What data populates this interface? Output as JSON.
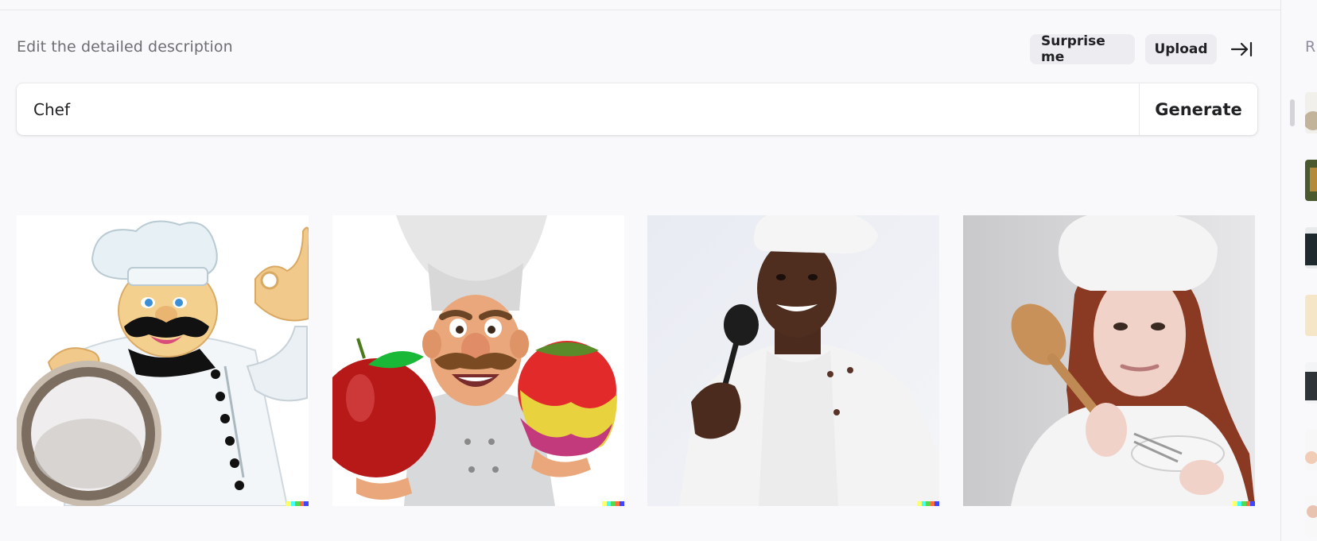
{
  "editor": {
    "label": "Edit the detailed description",
    "surprise_label": "Surprise me",
    "upload_label": "Upload",
    "prompt_value": "Chef",
    "generate_label": "Generate"
  },
  "results": {
    "images": [
      {
        "alt": "cartoon chef with mustache holding a tray and making an OK sign"
      },
      {
        "alt": "3D cartoon chef holding an apple and a dripping strawberry"
      },
      {
        "alt": "photo of a smiling chef holding a black ladle"
      },
      {
        "alt": "photo of a young woman chef holding a wooden spoon and whisk"
      }
    ],
    "signature_colors": [
      "#ffff66",
      "#42ffff",
      "#51da4c",
      "#ff6e3c",
      "#3c46ff"
    ]
  },
  "history": {
    "title": "R"
  },
  "icons": {
    "collapse": "arrow-right-to-line-icon"
  }
}
